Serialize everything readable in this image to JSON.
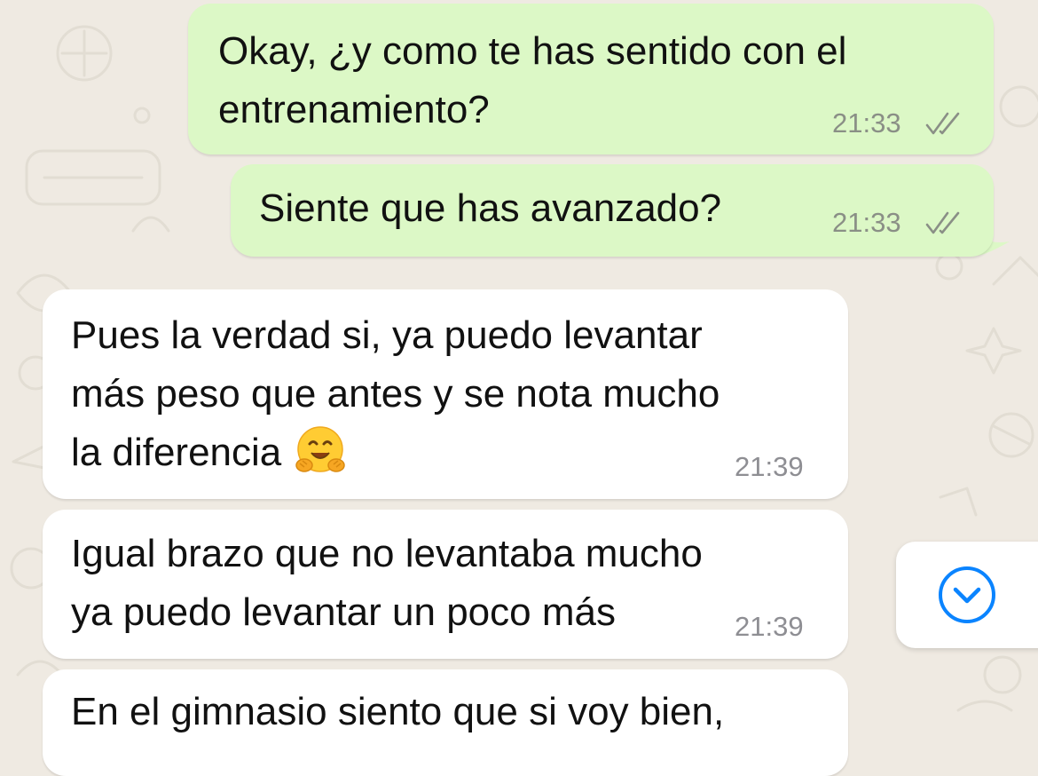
{
  "messages": [
    {
      "direction": "outgoing",
      "lines": [
        "Okay, ¿y como te has sentido con el",
        "entrenamiento?"
      ],
      "time": "21:33",
      "status": "read"
    },
    {
      "direction": "outgoing",
      "lines": [
        "Siente que has avanzado?"
      ],
      "time": "21:33",
      "status": "read"
    },
    {
      "direction": "incoming",
      "lines": [
        "Pues la verdad si, ya puedo levantar",
        "más peso que antes y se nota mucho",
        "la diferencia"
      ],
      "emoji": "hugging-face-emoji",
      "time": "21:39"
    },
    {
      "direction": "incoming",
      "lines": [
        "Igual brazo que no levantaba mucho",
        "ya puedo levantar un poco más"
      ],
      "time": "21:39"
    },
    {
      "direction": "incoming",
      "lines": [
        "En el gimnasio siento que si voy bien,"
      ],
      "time": ""
    }
  ],
  "scroll_button": {
    "icon": "chevron-down-circle-icon"
  },
  "colors": {
    "outgoing_bubble": "#dcf8c6",
    "incoming_bubble": "#ffffff",
    "wallpaper": "#efeae2",
    "read_ticks": "#8a8f86",
    "accent": "#0a84ff"
  }
}
